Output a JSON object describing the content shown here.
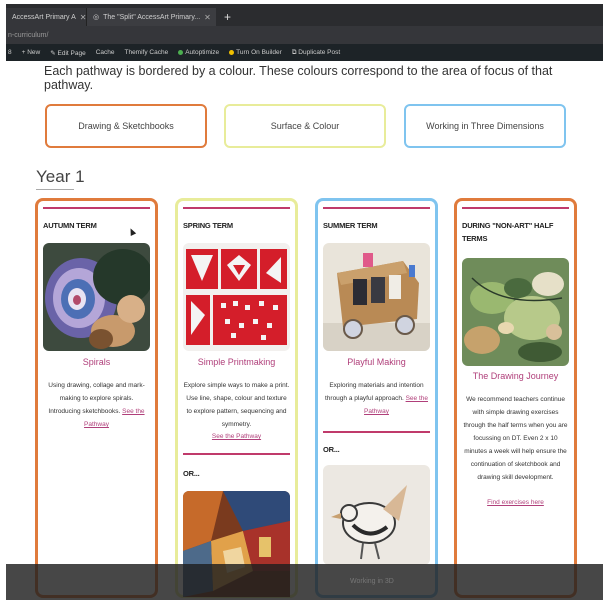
{
  "browser": {
    "tabs": [
      {
        "label": "AccessArt Primary A"
      },
      {
        "label": "The \"Split\" AccessArt Primary..."
      }
    ],
    "new_tab_label": "+",
    "url": "n-curriculum/"
  },
  "admin_bar": {
    "items": [
      "8",
      "+ New",
      "Edit Page",
      "Cache",
      "Themify Cache",
      "Autoptimize",
      "Turn On Builder",
      "Duplicate Post"
    ]
  },
  "intro_text": "Each pathway is bordered by a colour. These colours correspond to the area of focus of that pathway.",
  "pathways": [
    {
      "label": "Drawing & Sketchbooks",
      "color": "#e07b3c"
    },
    {
      "label": "Surface & Colour",
      "color": "#e8ec9a"
    },
    {
      "label": "Working in Three Dimensions",
      "color": "#7fc4ef"
    }
  ],
  "year_heading": "Year 1",
  "cards": [
    {
      "term": "AUTUMN TERM",
      "title": "Spirals",
      "description": "Using drawing, collage and mark-making to explore spirals. Introducing sketchbooks.",
      "link": "See the Pathway"
    },
    {
      "term": "SPRING TERM",
      "title": "Simple Printmaking",
      "description": "Explore simple ways to make a print. Use line, shape, colour and texture to explore pattern, sequencing and symmetry.",
      "link": "See the Pathway",
      "or_label": "OR..."
    },
    {
      "term": "SUMMER TERM",
      "title": "Playful Making",
      "description": "Exploring materials and intention through a playful approach.",
      "link": "See the Pathway",
      "or_label": "OR..."
    },
    {
      "term_line1": "DURING \"NON-ART\" HALF",
      "term_line2": "TERMS",
      "title": "The Drawing Journey",
      "description": "We recommend teachers continue with simple drawing exercises through the half terms when you are focussing on DT. Even 2 x 10 minutes a week will help ensure the continuation of sketchbook and drawing skill development.",
      "link": "Find exercises here"
    }
  ],
  "overlay": {
    "text": "Working in 3D"
  }
}
